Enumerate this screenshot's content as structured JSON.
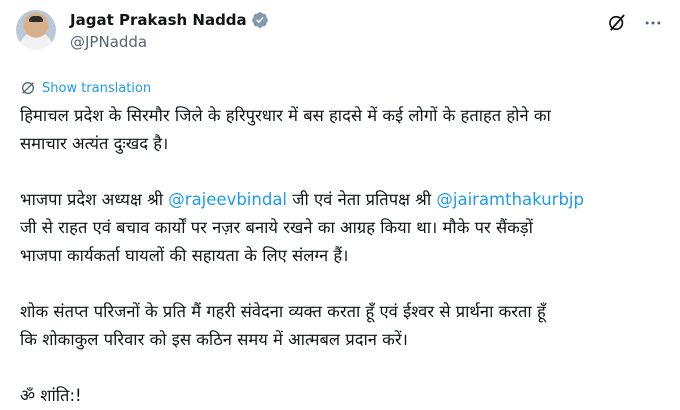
{
  "author": {
    "name": "Jagat Prakash Nadda",
    "handle": "@JPNadda"
  },
  "icons": {
    "verified": "verified-badge-icon",
    "grok": "grok-icon",
    "more": "more-options-icon",
    "translate": "translate-icon"
  },
  "colors": {
    "accent": "#1d9bf0",
    "text": "#0f1419",
    "muted": "#536471"
  },
  "translate_label": "Show translation",
  "tweet": {
    "p1_line1": "हिमाचल प्रदेश के सिरमौर जिले के हरिपुरधार में बस हादसे में कई लोगों के हताहत होने का",
    "p1_line2": "समाचार अत्यंत दुःखद है।",
    "p2_line1_a": "भाजपा प्रदेश अध्यक्ष श्री ",
    "mention1": "@rajeevbindal",
    "p2_line1_b": " जी एवं नेता प्रतिपक्ष श्री ",
    "mention2": "@jairamthakurbjp",
    "p2_line2": "जी से राहत एवं बचाव कार्यों पर नज़र बनाये रखने का आग्रह किया था। मौके पर सैंकड़ों",
    "p2_line3": "भाजपा कार्यकर्ता घायलों की सहायता के लिए संलग्न हैं।",
    "p3_line1": "शोक संतप्त परिजनों के प्रति मैं गहरी संवेदना व्यक्त करता हूँ एवं ईश्वर से प्रार्थना करता हूँ",
    "p3_line2": "कि शोकाकुल परिवार को इस कठिन समय में आत्मबल प्रदान करें।",
    "p4_line1": "ॐ शांति:!"
  }
}
